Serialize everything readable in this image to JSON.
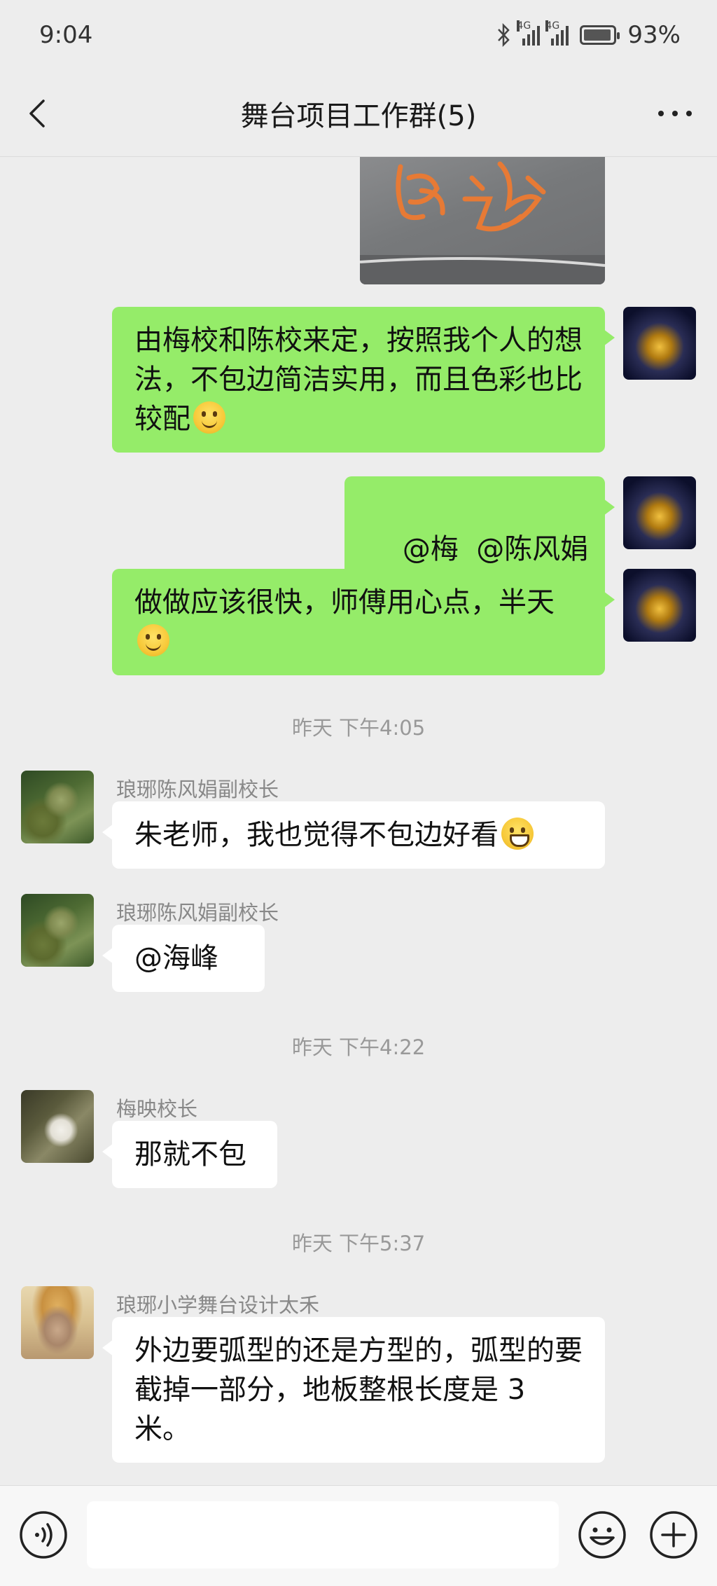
{
  "status_bar": {
    "time": "9:04",
    "network_1": "4G",
    "network_2": "4G",
    "battery": "93%"
  },
  "header": {
    "title": "舞台项目工作群(5)"
  },
  "messages": [
    {
      "type": "image",
      "from": "me",
      "handwriting": "包边"
    },
    {
      "type": "text",
      "from": "me",
      "text": "由梅校和陈校来定，按照我个人的想法，不包边简洁实用，而且色彩也比较配",
      "emoji": "smile"
    },
    {
      "type": "text",
      "from": "me",
      "text": "@梅  @陈风娟"
    },
    {
      "type": "text",
      "from": "me",
      "text": "做做应该很快，师傅用心点，半天",
      "emoji": "smile"
    },
    {
      "type": "time",
      "text": "昨天 下午4:05"
    },
    {
      "type": "text",
      "from": "other",
      "sender": "琅琊陈风娟副校长",
      "text": "朱老师，我也觉得不包边好看",
      "emoji": "grin"
    },
    {
      "type": "text",
      "from": "other",
      "sender": "琅琊陈风娟副校长",
      "text": "@海峰"
    },
    {
      "type": "time",
      "text": "昨天 下午4:22"
    },
    {
      "type": "text",
      "from": "other",
      "sender": "梅映校长",
      "text": "那就不包"
    },
    {
      "type": "time",
      "text": "昨天 下午5:37"
    },
    {
      "type": "text",
      "from": "other",
      "sender": "琅琊小学舞台设计太禾",
      "text": "外边要弧型的还是方型的，弧型的要截掉一部分，地板整根长度是 3 米。"
    }
  ],
  "input_bar": {
    "voice_icon": "voice-icon",
    "emoji_icon": "emoji-icon",
    "plus_icon": "plus-icon"
  },
  "colors": {
    "background": "#ededed",
    "my_bubble": "#95ec69",
    "other_bubble": "#ffffff",
    "meta_text": "#888888"
  }
}
